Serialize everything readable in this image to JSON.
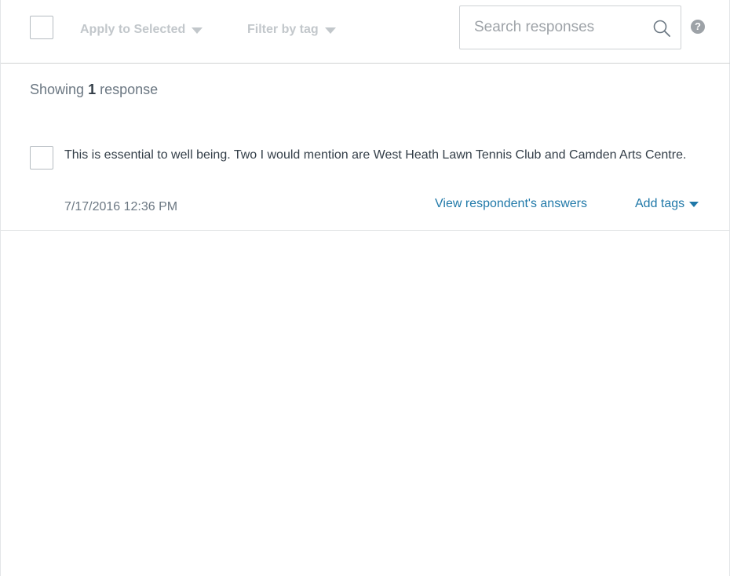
{
  "toolbar": {
    "apply_label": "Apply to Selected",
    "filter_label": "Filter by tag",
    "search_placeholder": "Search responses",
    "search_value": "",
    "help_glyph": "?"
  },
  "summary": {
    "prefix": "Showing",
    "count": "1",
    "suffix": "response"
  },
  "responses": [
    {
      "text": "This is essential to well being. Two I would mention are West Heath Lawn Tennis Club and Camden Arts Centre.",
      "date": "7/17/2016 12:36 PM",
      "view_label": "View respondent's answers",
      "tags_label": "Add tags"
    }
  ],
  "colors": {
    "link": "#1f78a8",
    "muted": "#c2c7cb",
    "text": "#333e48"
  },
  "icons": [
    "search-icon",
    "help-icon",
    "caret-down-icon"
  ]
}
